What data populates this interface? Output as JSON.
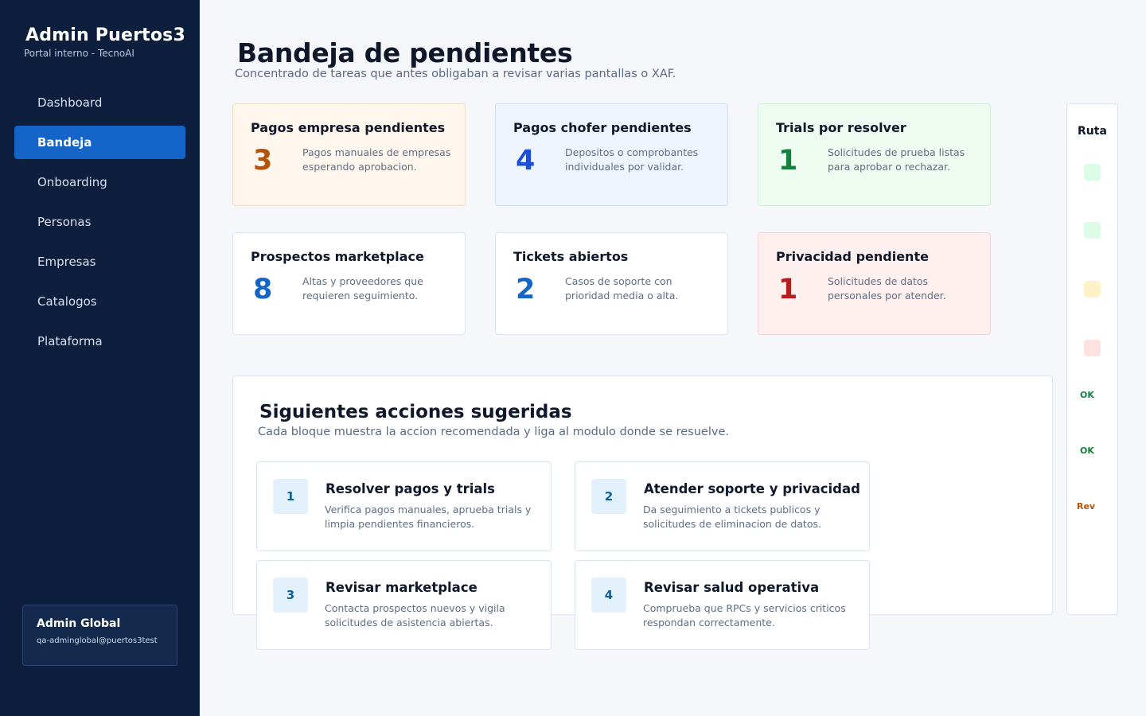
{
  "sidebar": {
    "title": "Admin Puertos3",
    "subtitle": "Portal interno - TecnoAI",
    "items": [
      {
        "label": "Dashboard"
      },
      {
        "label": "Bandeja"
      },
      {
        "label": "Onboarding"
      },
      {
        "label": "Personas"
      },
      {
        "label": "Empresas"
      },
      {
        "label": "Catalogos"
      },
      {
        "label": "Plataforma"
      }
    ],
    "active_item": "Bandeja",
    "user": {
      "name": "Admin Global",
      "email": "qa-adminglobal@puertos3test"
    }
  },
  "header": {
    "title": "Bandeja de pendientes",
    "subtitle": "Concentrado de tareas que antes obligaban a revisar varias pantallas o XAF."
  },
  "stats": [
    {
      "title": "Pagos empresa pendientes",
      "value": "3",
      "desc": "Pagos manuales de empresas esperando aprobacion.",
      "tone": "orange"
    },
    {
      "title": "Pagos chofer pendientes",
      "value": "4",
      "desc": "Depositos o comprobantes individuales por validar.",
      "tone": "blue"
    },
    {
      "title": "Trials por resolver",
      "value": "1",
      "desc": "Solicitudes de prueba listas para aprobar o rechazar.",
      "tone": "green"
    },
    {
      "title": "Prospectos marketplace",
      "value": "8",
      "desc": "Altas y proveedores que requieren seguimiento.",
      "tone": "white"
    },
    {
      "title": "Tickets abiertos",
      "value": "2",
      "desc": "Casos de soporte con prioridad media o alta.",
      "tone": "white"
    },
    {
      "title": "Privacidad pendiente",
      "value": "1",
      "desc": "Solicitudes de datos personales por atender.",
      "tone": "red"
    }
  ],
  "rail": {
    "title": "Ruta",
    "dots": [
      {
        "color": "#dcfce7"
      },
      {
        "color": "#dcfce7"
      },
      {
        "color": "#fef3c7"
      },
      {
        "color": "#fee2e2"
      }
    ],
    "labels": [
      {
        "text": "OK",
        "color": "#15803d"
      },
      {
        "text": "OK",
        "color": "#15803d"
      },
      {
        "text": "Rev",
        "color": "#b45309"
      }
    ]
  },
  "actions": {
    "title": "Siguientes acciones sugeridas",
    "subtitle": "Cada bloque muestra la accion recomendada y liga al modulo donde se resuelve.",
    "items": [
      {
        "num": "1",
        "title": "Resolver pagos y trials",
        "desc": "Verifica pagos manuales, aprueba trials y limpia pendientes financieros."
      },
      {
        "num": "2",
        "title": "Atender soporte y privacidad",
        "desc": "Da seguimiento a tickets publicos y solicitudes de eliminacion de datos."
      },
      {
        "num": "3",
        "title": "Revisar marketplace",
        "desc": "Contacta prospectos nuevos y vigila solicitudes de asistencia abiertas."
      },
      {
        "num": "4",
        "title": "Revisar salud operativa",
        "desc": "Comprueba que RPCs y servicios criticos respondan correctamente."
      }
    ]
  }
}
